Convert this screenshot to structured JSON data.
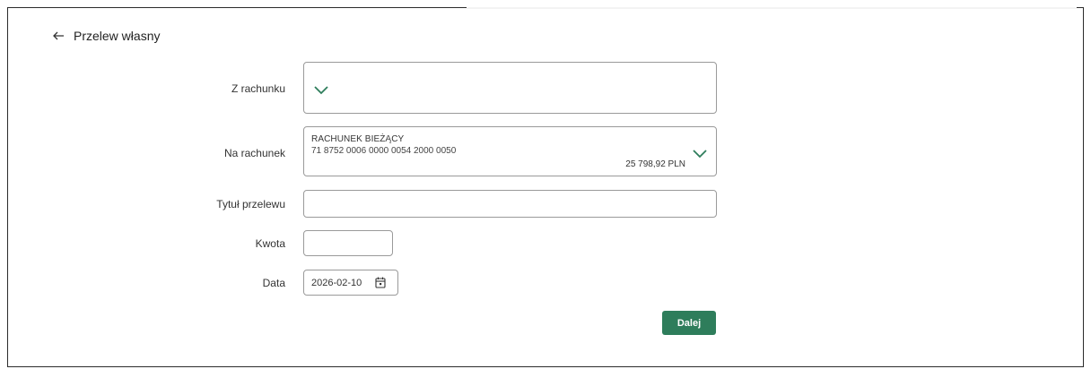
{
  "header": {
    "title": "Przelew własny"
  },
  "form": {
    "from_account": {
      "label": "Z rachunku",
      "value": ""
    },
    "to_account": {
      "label": "Na rachunek",
      "name": "RACHUNEK BIEŻĄCY",
      "number": "71 8752 0006 0000 0054 2000 0050",
      "balance": "25 798,92 PLN"
    },
    "title": {
      "label": "Tytuł przelewu",
      "value": ""
    },
    "amount": {
      "label": "Kwota",
      "value": ""
    },
    "date": {
      "label": "Data",
      "value": "2026-02-10"
    },
    "next_button": "Dalej"
  },
  "colors": {
    "accent": "#2e7d5b",
    "border": "#9a9a9a"
  },
  "icons": [
    "back-arrow-icon",
    "chevron-down-icon",
    "calendar-icon"
  ]
}
